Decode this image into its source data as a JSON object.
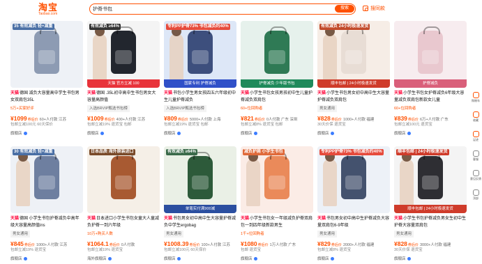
{
  "header": {
    "logo": "淘宝",
    "logo_sub": "Taobao.com",
    "search_value": "护脊书包",
    "search_button": "搜索",
    "photo_search": "搜同款"
  },
  "colors": {
    "accent": "#ff5000",
    "tmall": "#ff0036"
  },
  "products": [
    {
      "img_bg": "#eef1f6",
      "bag": "#8d9bb3",
      "kid": false,
      "badge": "35 有效减负 轻+减重",
      "badge_color": "#4a6fa5",
      "banner": "",
      "banner_bg": "#2a9d8f",
      "mall": "天猫",
      "title": "德国 减负大容量高中学生书包男女双肩包35L",
      "tag": "5万+买家好评",
      "tag_grey": false,
      "price": "¥1099",
      "price_label": "券后价",
      "sales": "60+人付款 江苏",
      "ship": "包邮立减100元 60天保价",
      "shop": "旗舰店"
    },
    {
      "img_bg": "#f4f4f4",
      "bag": "#22262e",
      "kid": true,
      "badge": "有效减负 ≥64%",
      "badge_color": "#333333",
      "banner": "天猫 官方立减 100",
      "banner_bg": "#e8333a",
      "mall": "天猫",
      "title": "德国 .35L初中高中生书包男女大容量高颜值",
      "tag": "入选BRVIP甄选书包榜",
      "tag_grey": true,
      "price": "¥1009",
      "price_label": "券后价",
      "sales": "400+人付款 江苏",
      "ship": "包邮立减19% 退货宝 包邮",
      "shop": "旗舰店"
    },
    {
      "img_bg": "#dde7f7",
      "bag": "#3d4f7d",
      "kid": true,
      "badge": "专利PP护脊73% 书包减负约40%",
      "badge_color": "#e64b3c",
      "banner": "国家专利 护脊减负",
      "banner_bg": "#3050c8",
      "mall": "天猫",
      "title": "书包小学生男女孩四五六年级初中生儿童护脊减负",
      "tag": "入选BRVIP甄选书包榜",
      "tag_grey": true,
      "price": "¥809",
      "price_label": "券后价",
      "sales": "5000+人付款 上海",
      "ship": "包邮立减19% 退货宝 包邮",
      "shop": "旗舰店"
    },
    {
      "img_bg": "#e6f1ec",
      "bag": "#2f7a55",
      "kid": false,
      "badge": "",
      "badge_color": "#2f7a55",
      "banner": "护脊减负 少年版书包",
      "banner_bg": "#1f8a5b",
      "mall": "天猫",
      "title": "小学生书包女孩男孩初中生儿童护脊减负双肩包",
      "tag": "60+位回购者",
      "tag_grey": false,
      "price": "¥821",
      "price_label": "券后价",
      "sales": "0人付款 广东 深圳",
      "ship": "包邮立减8% 退货宝 包邮",
      "shop": "旗舰店"
    },
    {
      "img_bg": "#f6ede6",
      "bag": "#e8ddd5",
      "kid": true,
      "badge": "有效减负 24小时极速发货",
      "badge_color": "#c24a2a",
      "banner": "顺丰包邮 | 24小时极速发货",
      "banner_bg": "#cf3b2a",
      "mall": "天猫",
      "title": "小学生书包男女初中高中生大容量护脊减负双肩包",
      "tag": "男女通用",
      "tag_grey": true,
      "price": "¥828",
      "price_label": "券后价",
      "sales": "1000+人付款 福建",
      "ship": "30天价保 退货宝",
      "shop": "旗舰店"
    },
    {
      "img_bg": "#f7ecef",
      "bag": "#e9c8cf",
      "kid": false,
      "badge": "",
      "badge_color": "#c26a7d",
      "banner": "护脊减负",
      "banner_bg": "#d95f7a",
      "mall": "天猫",
      "title": "小学生书包女护脊减负6年级大容量减负双肩包新款女儿童",
      "tag": "60+位回购者",
      "tag_grey": false,
      "price": "¥839",
      "price_label": "券后价",
      "sales": "6万+人付款 广东",
      "ship": "包邮立减100元 退货宝",
      "shop": "旗舰店"
    },
    {
      "img_bg": "#eef1f6",
      "bag": "#6e7fa0",
      "kid": true,
      "badge": "30 有效减负 轻+减重",
      "badge_color": "#4a6fa5",
      "banner": "",
      "banner_bg": "#2a9d8f",
      "mall": "天猫",
      "title": "德国 小学生书包护脊减负中高年级大容量高颜值ins",
      "tag": "男女通用",
      "tag_grey": true,
      "price": "¥845",
      "price_label": "券后价",
      "sales": "1000+人付款 江苏",
      "ship": "包邮立减19% 退货宝",
      "shop": "旗舰店"
    },
    {
      "img_bg": "#f5efe7",
      "bag": "#a85a32",
      "kid": false,
      "badge": "日本品质 海外原装进口",
      "badge_color": "#7a4b2a",
      "banner": "",
      "banner_bg": "#a85a32",
      "mall": "天猫",
      "title": "日本进口小学生书包女童大人童减负护脊一到六年级",
      "tag": "10万+购买人数",
      "tag_grey": false,
      "price": "¥1064.1",
      "price_label": "券后价",
      "sales": "0人付款",
      "ship": "包邮立减19% 退货宝",
      "shop": "海外旗舰店"
    },
    {
      "img_bg": "#eaf0e6",
      "bag": "#2d5a3a",
      "kid": false,
      "badge": "有效减负 ≥64%",
      "badge_color": "#3a6a4a",
      "banner": "单笔实付满900减",
      "banner_bg": "#2b4fa0",
      "mall": "天猫",
      "title": "书包男女初中高中生大容量护脊减负中学生ergobag",
      "tag": "男女通用",
      "tag_grey": true,
      "price": "¥1008.39",
      "price_label": "券后价",
      "sales": "100+人付款 江苏",
      "ship": "包邮立减100元 60天保价",
      "shop": "旗舰店"
    },
    {
      "img_bg": "#fbece6",
      "bag": "#ea8a5a",
      "kid": true,
      "badge": "减负护肩 小学生书包",
      "badge_color": "#e06a3a",
      "banner": "",
      "banner_bg": "#e06a3a",
      "mall": "天猫",
      "title": "小学生书包女一年级减负护脊双肩包一到四年级新款男生",
      "tag": "1千+位回购者",
      "tag_grey": false,
      "price": "¥1080",
      "price_label": "券后价",
      "sales": "1万人付款 广东",
      "ship": "包邮 退货宝",
      "shop": "旗舰店"
    },
    {
      "img_bg": "#edf1f7",
      "bag": "#44526e",
      "kid": true,
      "badge": "专利PP护脊73% 书包减负约40%",
      "badge_color": "#e64b3c",
      "banner": "",
      "banner_bg": "#3050c8",
      "mall": "天猫",
      "title": "书包男女初中高中生护脊减负大容量双肩包6-9年级",
      "tag": "男女通用",
      "tag_grey": true,
      "price": "¥829",
      "price_label": "券后价",
      "sales": "2000+人付款 福建",
      "ship": "包邮立减8% 退货宝",
      "shop": "旗舰店"
    },
    {
      "img_bg": "#f4f4f4",
      "bag": "#2e2e33",
      "kid": true,
      "badge": "顺丰包邮 | 24小时极速发货",
      "badge_color": "#cf3b2a",
      "banner": "顺丰包邮 | 24小时极速发货",
      "banner_bg": "#cf3b2a",
      "mall": "天猫",
      "title": "小学生书包护脊减负男女生初中生护脊大容量双肩包",
      "tag": "男女通用",
      "tag_grey": true,
      "price": "¥828",
      "price_label": "券后价",
      "sales": "3000+人付款 福建",
      "ship": "30天价保 退货宝",
      "shop": "旗舰店"
    }
  ],
  "sidebar": [
    {
      "label": "购物车",
      "color": "#ff5000"
    },
    {
      "label": "收藏",
      "color": "#ff5000"
    },
    {
      "label": "足迹",
      "color": "#ff5000"
    },
    {
      "label": "客服",
      "color": "#888888"
    },
    {
      "label": "意见反馈",
      "color": "#888888"
    },
    {
      "label": "顶部",
      "color": "#888888"
    }
  ]
}
